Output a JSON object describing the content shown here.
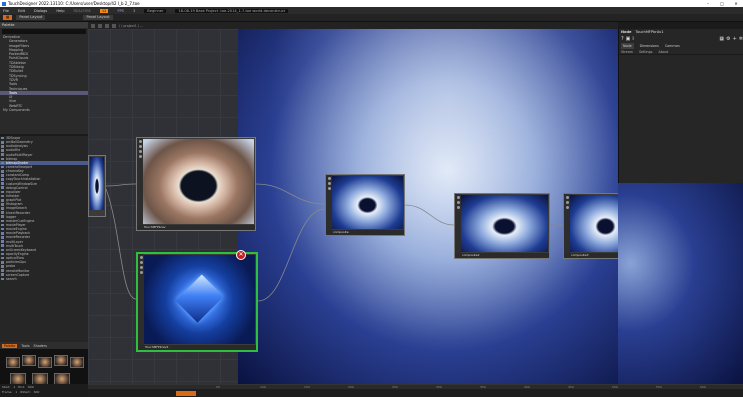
{
  "window": {
    "title": "TouchDesigner 2022.13110: C:/Users/user/Desktop/42 I_b 2_7.toe",
    "controls": [
      "–",
      "□",
      "✕"
    ]
  },
  "menu": {
    "items": [
      "File",
      "Edit",
      "Dialogs",
      "Help"
    ],
    "realtime_label": "REALTIME",
    "fps_label": "FPS",
    "fps_value": "3",
    "fields": [
      "12",
      "Beginner",
      "18-08-19 Base Project .toe-2014_1-7.toe world-deconstruct"
    ]
  },
  "toolbar": {
    "left_tab": "Panel Layout",
    "mid_tab": "Panel Layout"
  },
  "palette": {
    "header": "Palette",
    "tree": [
      {
        "label": "Derivative",
        "level": 0
      },
      {
        "label": "Generators",
        "level": 1
      },
      {
        "label": "ImageFilters",
        "level": 1
      },
      {
        "label": "Mapping",
        "level": 1
      },
      {
        "label": "PackedMIDI",
        "level": 1
      },
      {
        "label": "PointClouds",
        "level": 1
      },
      {
        "label": "TDAbleton",
        "level": 1
      },
      {
        "label": "TDBitwig",
        "level": 1
      },
      {
        "label": "TDBullet",
        "level": 1
      },
      {
        "label": "TDSyncing",
        "level": 1
      },
      {
        "label": "TDVR",
        "level": 1
      },
      {
        "label": "Tools",
        "level": 1
      },
      {
        "label": "Techniques",
        "level": 1
      },
      {
        "label": "Tools",
        "level": 1,
        "selected": true
      },
      {
        "label": "UI",
        "level": 1
      },
      {
        "label": "Vive",
        "level": 1
      },
      {
        "label": "WebRTC",
        "level": 1
      },
      {
        "label": "My Components",
        "level": 0
      }
    ]
  },
  "components": [
    "3DScope",
    "arcBallGeometry",
    "audioAnalysis",
    "audioFile",
    "audioMultiPlayer",
    "bitmap",
    "bitmapShader",
    "cameraViewport",
    "chromaKey",
    "constantComp",
    "copyTouchInstallation",
    "customWindowSize",
    "debugControl",
    "equalizer",
    "fxHolder",
    "graphPlot",
    "Histogram",
    "imageSearch",
    "kinectRecorder",
    "logger",
    "masterCueEngine",
    "moviePlayer",
    "movieEngine",
    "moviePlayback",
    "movieRecorder",
    "multiLayer",
    "multiTouch",
    "onScreenKeyboard",
    "opacityEngine",
    "opticalFlow",
    "particlesGpu",
    "probe",
    "remoteMonitor",
    "screenCapture",
    "search"
  ],
  "bottom_tabs": [
    "Palette",
    "Tools",
    "Shaders"
  ],
  "network": {
    "path": "/ / project1 / ...",
    "nodes": [
      {
        "label": "TouchMFPbrAv",
        "kind": "face"
      },
      {
        "label": "TouchMFPbrAv2",
        "kind": "crystal"
      },
      {
        "label": "composite",
        "kind": "comp"
      },
      {
        "label": "composite2",
        "kind": "comp"
      },
      {
        "label": "composite3",
        "kind": "comp"
      }
    ],
    "close_icon": "✕"
  },
  "parameters": {
    "op_type": "Node",
    "op_name": "TouchMFPbrAv1",
    "tabs": [
      "Node",
      "Dimensions",
      "Common"
    ],
    "rows": [
      "Stream",
      "Settings",
      "About"
    ]
  },
  "timeline": {
    "labels": [
      "Start:",
      "1",
      "End:",
      "600",
      "Frame:",
      "1",
      "RStart:",
      "600"
    ],
    "ticks": [
      "50",
      "100",
      "150",
      "200",
      "250",
      "300",
      "350",
      "400",
      "450",
      "500",
      "550",
      "600"
    ]
  }
}
